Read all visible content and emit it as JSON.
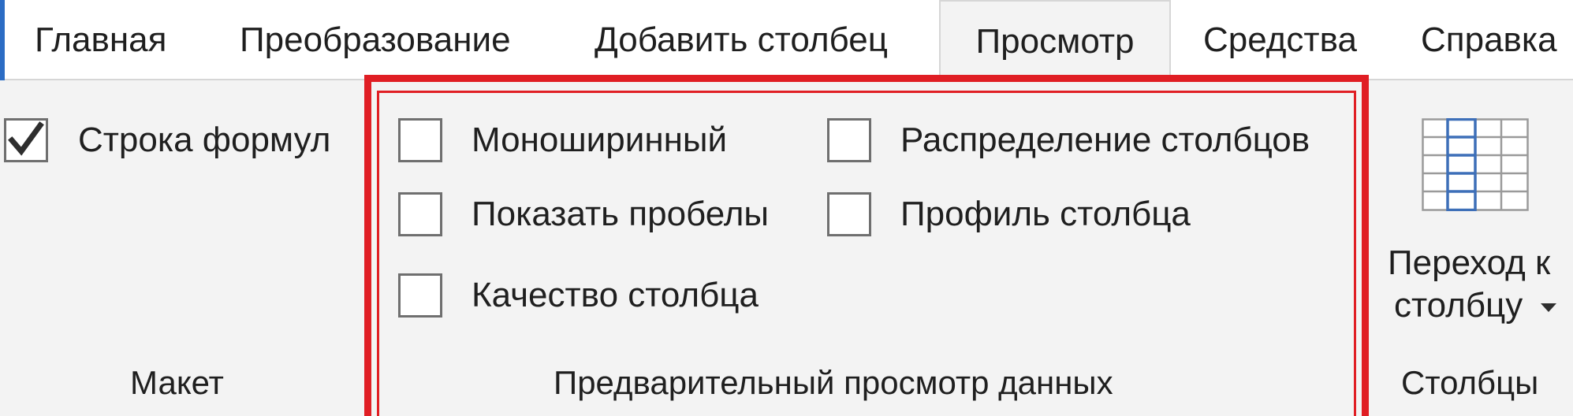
{
  "tabs": [
    {
      "label": "Главная",
      "active": false
    },
    {
      "label": "Преобразование",
      "active": false
    },
    {
      "label": "Добавить столбец",
      "active": false
    },
    {
      "label": "Просмотр",
      "active": true
    },
    {
      "label": "Средства",
      "active": false
    },
    {
      "label": "Справка",
      "active": false
    }
  ],
  "groups": {
    "layout": {
      "label": "Макет",
      "formula_bar": {
        "label": "Строка формул",
        "checked": true
      }
    },
    "data_preview": {
      "label": "Предварительный просмотр данных",
      "options": [
        {
          "label": "Моноширинный",
          "checked": false
        },
        {
          "label": "Показать пробелы",
          "checked": false
        },
        {
          "label": "Качество столбца",
          "checked": false
        },
        {
          "label": "Распределение столбцов",
          "checked": false
        },
        {
          "label": "Профиль столбца",
          "checked": false
        }
      ]
    },
    "columns": {
      "label": "Столбцы",
      "goto_column": {
        "line1": "Переход к",
        "line2": "столбцу",
        "icon": "column-grid-icon"
      }
    }
  },
  "colors": {
    "accent": "#2b6cc4",
    "highlight": "#e01e24",
    "check": "#2e2e2e",
    "grid_blue": "#3d6fb8"
  }
}
